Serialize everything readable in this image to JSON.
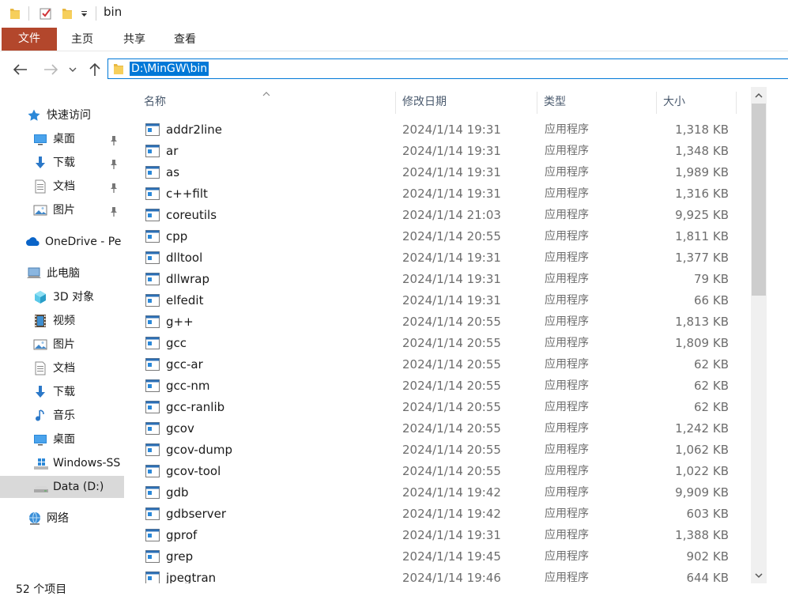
{
  "window": {
    "title": "bin"
  },
  "ribbon": {
    "tabs": [
      "文件",
      "主页",
      "共享",
      "查看"
    ]
  },
  "address": {
    "path": "D:\\MinGW\\bin"
  },
  "navigation": {
    "items": [
      {
        "label": "快速访问",
        "icon": "star-icon",
        "pinned": false
      },
      {
        "label": "桌面",
        "icon": "desktop-icon",
        "pinned": true
      },
      {
        "label": "下载",
        "icon": "download-icon",
        "pinned": true
      },
      {
        "label": "文档",
        "icon": "documents-icon",
        "pinned": true
      },
      {
        "label": "图片",
        "icon": "pictures-icon",
        "pinned": true
      },
      {
        "label": "OneDrive - Pe",
        "icon": "cloud-icon",
        "pinned": false
      },
      {
        "label": "此电脑",
        "icon": "computer-icon",
        "pinned": false
      },
      {
        "label": "3D 对象",
        "icon": "3d-objects-icon",
        "pinned": false
      },
      {
        "label": "视频",
        "icon": "video-icon",
        "pinned": false
      },
      {
        "label": "图片",
        "icon": "pictures-icon",
        "pinned": false
      },
      {
        "label": "文档",
        "icon": "documents-icon",
        "pinned": false
      },
      {
        "label": "下载",
        "icon": "download-icon",
        "pinned": false
      },
      {
        "label": "音乐",
        "icon": "music-icon",
        "pinned": false
      },
      {
        "label": "桌面",
        "icon": "desktop-icon",
        "pinned": false
      },
      {
        "label": "Windows-SS",
        "icon": "windows-drive-icon",
        "pinned": false
      },
      {
        "label": "Data (D:)",
        "icon": "drive-icon",
        "pinned": false,
        "selected": true
      },
      {
        "label": "网络",
        "icon": "network-icon",
        "pinned": false
      }
    ]
  },
  "list": {
    "columns": [
      "名称",
      "修改日期",
      "类型",
      "大小"
    ],
    "files": [
      {
        "name": "addr2line",
        "date": "2024/1/14 19:31",
        "type": "应用程序",
        "size": "1,318 KB"
      },
      {
        "name": "ar",
        "date": "2024/1/14 19:31",
        "type": "应用程序",
        "size": "1,348 KB"
      },
      {
        "name": "as",
        "date": "2024/1/14 19:31",
        "type": "应用程序",
        "size": "1,989 KB"
      },
      {
        "name": "c++filt",
        "date": "2024/1/14 19:31",
        "type": "应用程序",
        "size": "1,316 KB"
      },
      {
        "name": "coreutils",
        "date": "2024/1/14 21:03",
        "type": "应用程序",
        "size": "9,925 KB"
      },
      {
        "name": "cpp",
        "date": "2024/1/14 20:55",
        "type": "应用程序",
        "size": "1,811 KB"
      },
      {
        "name": "dlltool",
        "date": "2024/1/14 19:31",
        "type": "应用程序",
        "size": "1,377 KB"
      },
      {
        "name": "dllwrap",
        "date": "2024/1/14 19:31",
        "type": "应用程序",
        "size": "79 KB"
      },
      {
        "name": "elfedit",
        "date": "2024/1/14 19:31",
        "type": "应用程序",
        "size": "66 KB"
      },
      {
        "name": "g++",
        "date": "2024/1/14 20:55",
        "type": "应用程序",
        "size": "1,813 KB"
      },
      {
        "name": "gcc",
        "date": "2024/1/14 20:55",
        "type": "应用程序",
        "size": "1,809 KB"
      },
      {
        "name": "gcc-ar",
        "date": "2024/1/14 20:55",
        "type": "应用程序",
        "size": "62 KB"
      },
      {
        "name": "gcc-nm",
        "date": "2024/1/14 20:55",
        "type": "应用程序",
        "size": "62 KB"
      },
      {
        "name": "gcc-ranlib",
        "date": "2024/1/14 20:55",
        "type": "应用程序",
        "size": "62 KB"
      },
      {
        "name": "gcov",
        "date": "2024/1/14 20:55",
        "type": "应用程序",
        "size": "1,242 KB"
      },
      {
        "name": "gcov-dump",
        "date": "2024/1/14 20:55",
        "type": "应用程序",
        "size": "1,062 KB"
      },
      {
        "name": "gcov-tool",
        "date": "2024/1/14 20:55",
        "type": "应用程序",
        "size": "1,022 KB"
      },
      {
        "name": "gdb",
        "date": "2024/1/14 19:42",
        "type": "应用程序",
        "size": "9,909 KB"
      },
      {
        "name": "gdbserver",
        "date": "2024/1/14 19:42",
        "type": "应用程序",
        "size": "603 KB"
      },
      {
        "name": "gprof",
        "date": "2024/1/14 19:31",
        "type": "应用程序",
        "size": "1,388 KB"
      },
      {
        "name": "grep",
        "date": "2024/1/14 19:45",
        "type": "应用程序",
        "size": "902 KB"
      },
      {
        "name": "jpegtran",
        "date": "2024/1/14 19:46",
        "type": "应用程序",
        "size": "644 KB"
      }
    ]
  },
  "status": {
    "item_count": "52 个项目"
  },
  "colors": {
    "file_tab": "#b3472c",
    "accent": "#0078d7",
    "selected_nav": "#d9d9d9"
  }
}
